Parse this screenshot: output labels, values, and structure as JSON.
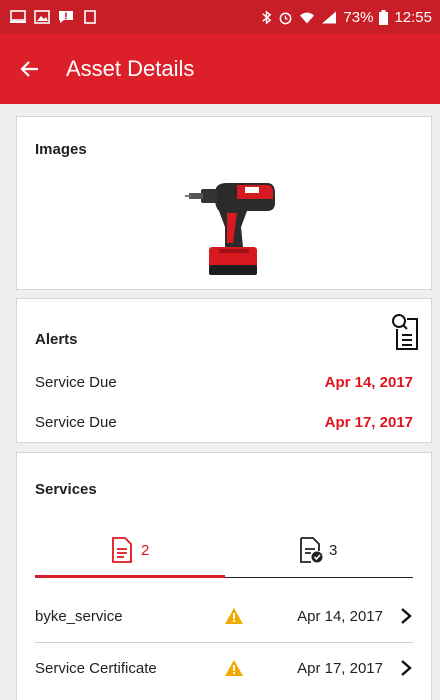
{
  "status_bar": {
    "battery": "73%",
    "time": "12:55"
  },
  "app_bar": {
    "title": "Asset Details"
  },
  "images_section": {
    "title": "Images",
    "image_icon": "power-drill"
  },
  "alerts_section": {
    "title": "Alerts",
    "items": [
      {
        "label": "Service Due",
        "date": "Apr 14, 2017"
      },
      {
        "label": "Service Due",
        "date": "Apr 17, 2017"
      }
    ]
  },
  "services_section": {
    "title": "Services",
    "tabs": [
      {
        "icon": "document-icon",
        "count": "2",
        "active": true
      },
      {
        "icon": "document-check-icon",
        "count": "3",
        "active": false
      }
    ],
    "items": [
      {
        "name": "byke_service",
        "date": "Apr 14, 2017"
      },
      {
        "name": "Service Certificate",
        "date": "Apr 17, 2017"
      }
    ]
  },
  "colors": {
    "primary": "#dd1f2a",
    "status_bar": "#c81e28",
    "alert_date": "#e0141e",
    "warning": "#f2a900"
  }
}
